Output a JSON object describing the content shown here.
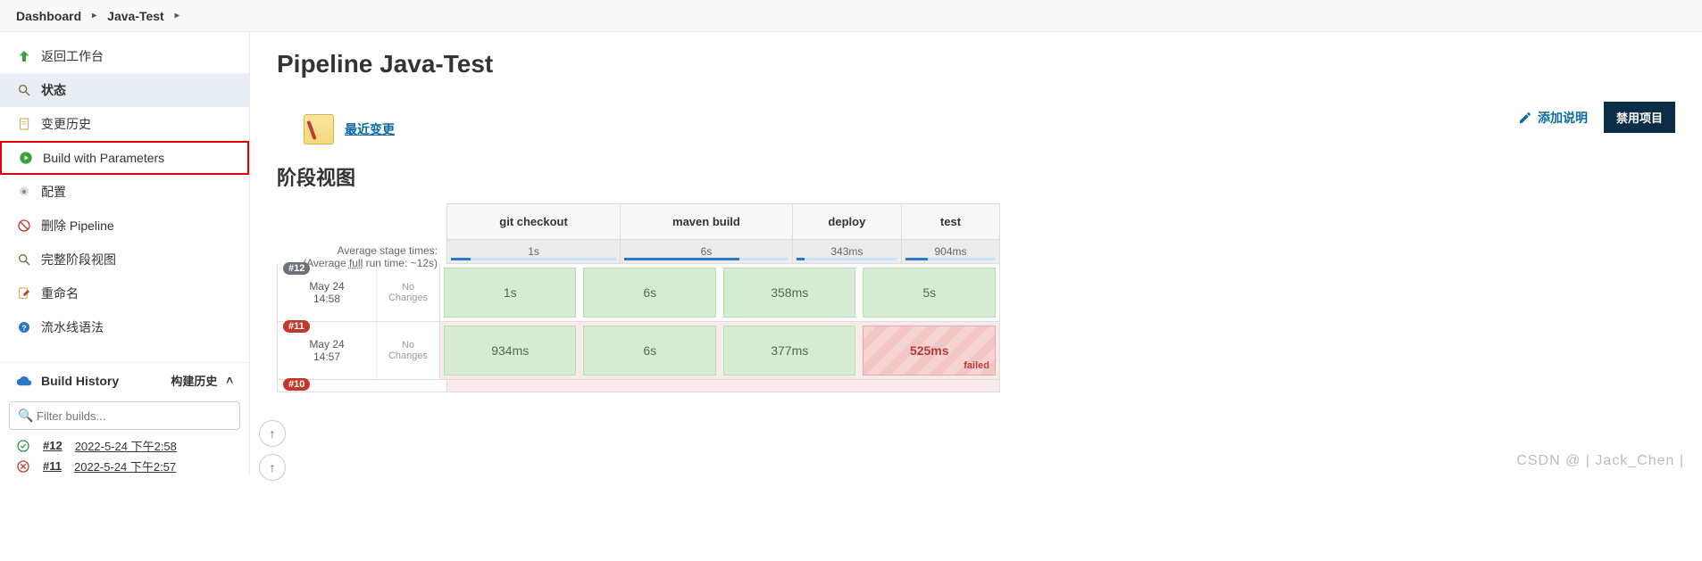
{
  "breadcrumb": {
    "items": [
      "Dashboard",
      "Java-Test"
    ]
  },
  "sidebar": {
    "items": [
      {
        "key": "back",
        "label": "返回工作台",
        "icon": "up-arrow-green"
      },
      {
        "key": "status",
        "label": "状态",
        "icon": "search",
        "active": true
      },
      {
        "key": "changes",
        "label": "变更历史",
        "icon": "doc"
      },
      {
        "key": "build-params",
        "label": "Build with Parameters",
        "icon": "play-green",
        "highlighted": true
      },
      {
        "key": "config",
        "label": "配置",
        "icon": "gear"
      },
      {
        "key": "delete",
        "label": "删除 Pipeline",
        "icon": "no-entry"
      },
      {
        "key": "full-stage",
        "label": "完整阶段视图",
        "icon": "search"
      },
      {
        "key": "rename",
        "label": "重命名",
        "icon": "doc-edit"
      },
      {
        "key": "syntax",
        "label": "流水线语法",
        "icon": "help"
      }
    ]
  },
  "buildHistory": {
    "title": "Build History",
    "trend_label": "构建历史",
    "filter_placeholder": "Filter builds...",
    "builds": [
      {
        "num": "#12",
        "time": "2022-5-24 下午2:58",
        "status": "ok"
      },
      {
        "num": "#11",
        "time": "2022-5-24 下午2:57",
        "status": "fail"
      }
    ]
  },
  "page": {
    "title": "Pipeline Java-Test",
    "add_desc": "添加说明",
    "disable": "禁用项目",
    "recent_changes": "最近变更",
    "stage_view_title": "阶段视图"
  },
  "stages": {
    "columns": [
      "git checkout",
      "maven build",
      "deploy",
      "test"
    ],
    "avg_label_line1": "Average stage times:",
    "avg_label_line2_prefix": "(Average ",
    "avg_label_line2_full": "full",
    "avg_label_line2_suffix": " run time: ~12s)",
    "avg": [
      "1s",
      "6s",
      "343ms",
      "904ms"
    ],
    "avg_prog": [
      12,
      70,
      8,
      25
    ],
    "rows": [
      {
        "badge": "#12",
        "status": "ok",
        "date": "May 24",
        "time": "14:58",
        "changes": "No\nChanges",
        "cells": [
          {
            "v": "1s",
            "s": "ok"
          },
          {
            "v": "6s",
            "s": "ok"
          },
          {
            "v": "358ms",
            "s": "ok"
          },
          {
            "v": "5s",
            "s": "ok"
          }
        ]
      },
      {
        "badge": "#11",
        "status": "fail",
        "date": "May 24",
        "time": "14:57",
        "changes": "No\nChanges",
        "cells": [
          {
            "v": "934ms",
            "s": "ok"
          },
          {
            "v": "6s",
            "s": "ok"
          },
          {
            "v": "377ms",
            "s": "ok"
          },
          {
            "v": "525ms",
            "s": "fail",
            "flag": "failed"
          }
        ]
      },
      {
        "badge": "#10",
        "status": "fail",
        "partial": true
      }
    ]
  },
  "watermark": "CSDN @ | Jack_Chen |"
}
